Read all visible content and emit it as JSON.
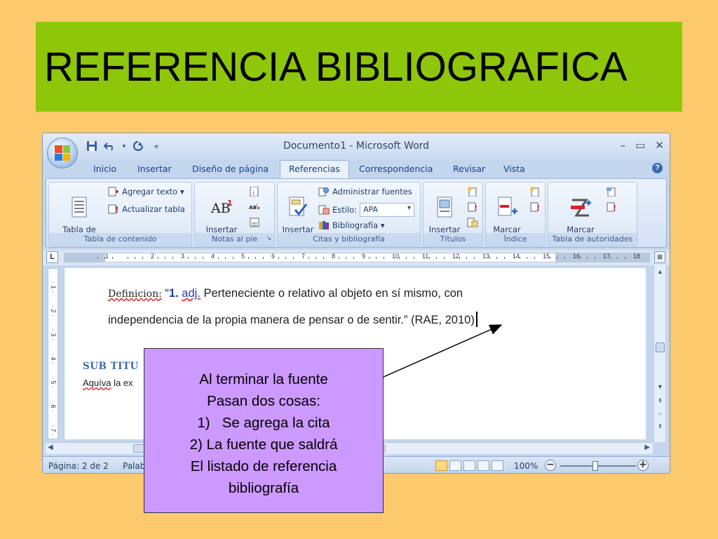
{
  "slide": {
    "title": "REFERENCIA BIBLIOGRAFICA"
  },
  "window": {
    "title": "Documento1 - Microsoft Word",
    "controls": {
      "minimize": "–",
      "maximize": "▭",
      "close": "✕"
    }
  },
  "tabs": [
    "Inicio",
    "Insertar",
    "Diseño de página",
    "Referencias",
    "Correspondencia",
    "Revisar",
    "Vista"
  ],
  "active_tab": "Referencias",
  "ribbon": {
    "tabla_contenido": {
      "big_button": "Tabla de\ncontenido ▾",
      "agregar_texto": "Agregar texto ▾",
      "actualizar_tabla": "Actualizar tabla",
      "group_label": "Tabla de contenido"
    },
    "notas": {
      "big_button": "Insertar\nnota al pie",
      "group_label": "Notas al pie"
    },
    "citas": {
      "big_button": "Insertar\ncita ▾",
      "administrar_fuentes": "Administrar fuentes",
      "estilo_label": "Estilo:",
      "estilo_value": "APA",
      "bibliografia": "Bibliografía ▾",
      "group_label": "Citas y bibliografía"
    },
    "titulos": {
      "big_button": "Insertar\ntítulo",
      "group_label": "Títulos"
    },
    "indice": {
      "big_button": "Marcar\nentrada",
      "group_label": "Índice"
    },
    "autoridades": {
      "big_button": "Marcar\ncita",
      "group_label": "Tabla de autoridades"
    }
  },
  "document": {
    "definition_label": "Definicion:",
    "quote_open": " “",
    "number": "1.",
    "adj": "adj.",
    "line1_rest": " Perteneciente  o relativo al objeto en sí mismo, con",
    "line2": "independencia de la propia manera de pensar o de sentir.” (RAE, 2010)",
    "sub_title": "SUB TITU",
    "sub_body_u": "Aquíva",
    "sub_body_rest": " la ex"
  },
  "status": {
    "page": "Página: 2 de 2",
    "words": "Palab",
    "zoom": "100%"
  },
  "callout": {
    "lines": [
      "Al terminar la fuente",
      "Pasan dos cosas:",
      "1)   Se agrega la cita",
      "2) La fuente que saldrá",
      "El listado de referencia",
      "bibliografía"
    ]
  },
  "colors": {
    "slide_bg": "#fcc96c",
    "title_bg": "#8ec60a",
    "callout_bg": "#cc99ff"
  }
}
